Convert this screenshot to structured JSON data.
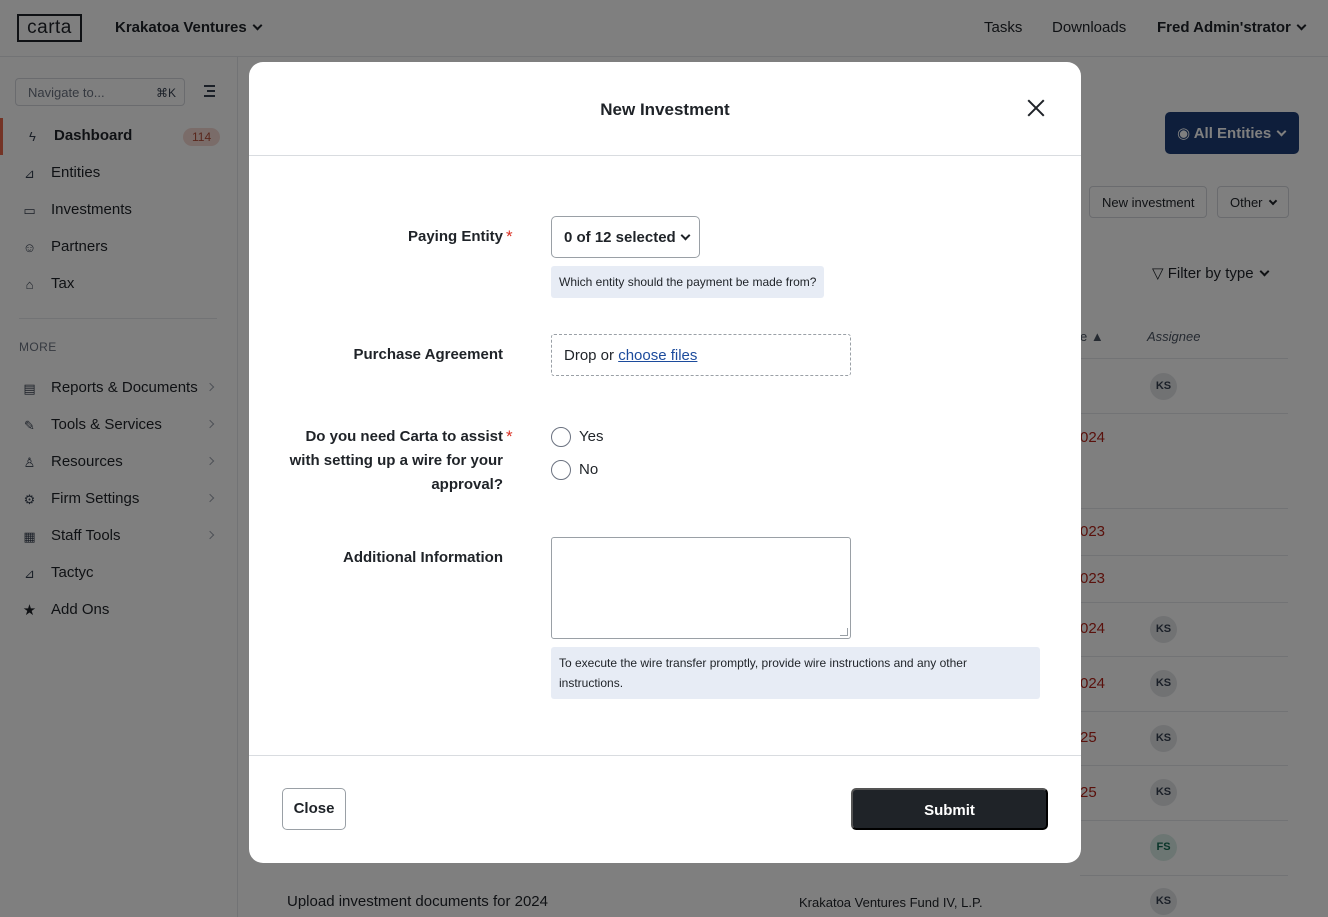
{
  "topbar": {
    "logo": "carta",
    "firm_name": "Krakatoa Ventures",
    "nav": [
      "Tasks",
      "Downloads"
    ],
    "user": "Fred Admin'strator"
  },
  "sidebar": {
    "search_placeholder": "Navigate to...",
    "search_shortcut": "⌘K",
    "items": [
      {
        "label": "Dashboard",
        "icon": "bolt-icon",
        "badge": "114"
      },
      {
        "label": "Entities",
        "icon": "chart-icon"
      },
      {
        "label": "Investments",
        "icon": "briefcase-icon"
      },
      {
        "label": "Partners",
        "icon": "people-icon"
      },
      {
        "label": "Tax",
        "icon": "bank-icon"
      }
    ],
    "more_label": "MORE",
    "more_items": [
      {
        "label": "Reports & Documents",
        "icon": "document-icon"
      },
      {
        "label": "Tools & Services",
        "icon": "tools-icon"
      },
      {
        "label": "Resources",
        "icon": "resources-icon"
      },
      {
        "label": "Firm Settings",
        "icon": "gear-icon"
      },
      {
        "label": "Staff Tools",
        "icon": "staff-icon"
      },
      {
        "label": "Tactyc",
        "icon": "chart-icon"
      },
      {
        "label": "Add Ons",
        "icon": "star-icon"
      }
    ]
  },
  "background": {
    "all_entities": "All Entities",
    "new_investment_btn": "New investment",
    "other_btn": "Other",
    "filter_by_type": "Filter by type",
    "col_due_fragment": "e",
    "col_assignee": "Assignee",
    "red_dates": [
      "024",
      "023",
      "023",
      "024",
      "024",
      "25",
      "25"
    ],
    "avatars": [
      "KS",
      "KS",
      "KS",
      "KS",
      "KS",
      "FS",
      "KS"
    ],
    "last_row_title": "Upload investment documents for 2024",
    "last_row_entity": "Krakatoa Ventures Fund IV, L.P."
  },
  "modal": {
    "title": "New Investment",
    "paying_entity": {
      "label": "Paying Entity",
      "value": "0 of 12 selected",
      "hint": "Which entity should the payment be made from?"
    },
    "purchase_agreement": {
      "label": "Purchase Agreement",
      "drop_text": "Drop or ",
      "link_text": "choose files"
    },
    "wire_assist": {
      "label_lines": [
        "Do you need Carta to assist",
        "with setting up a wire for your",
        "approval?"
      ],
      "options": [
        "Yes",
        "No"
      ]
    },
    "additional_info": {
      "label": "Additional Information",
      "value": "",
      "hint": "To execute the wire transfer promptly, provide wire instructions and any other instructions."
    },
    "close_label": "Close",
    "submit_label": "Submit"
  }
}
